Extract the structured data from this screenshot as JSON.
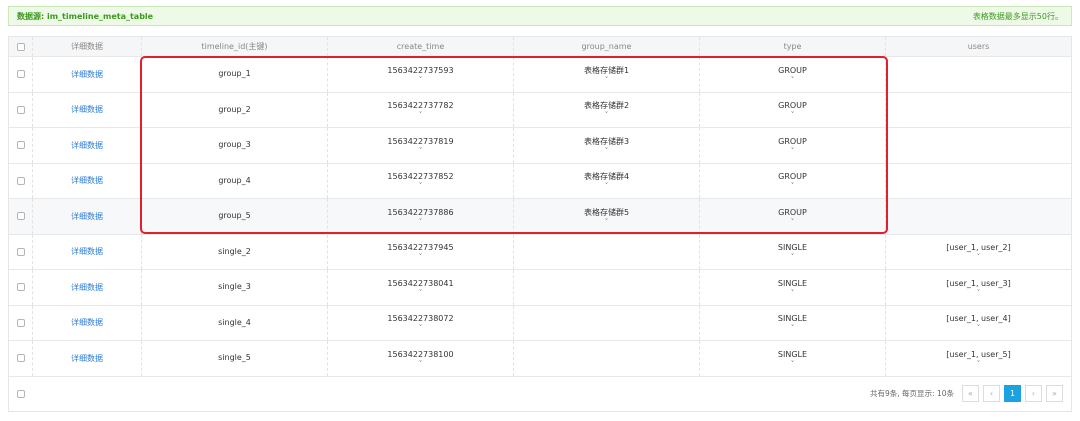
{
  "banner": {
    "source_label": "数据源: im_timeline_meta_table",
    "limit_note": "表格数据最多显示50行。"
  },
  "table": {
    "headers": [
      "详细数据",
      "timeline_id(主键)",
      "create_time",
      "group_name",
      "type",
      "users"
    ],
    "rows": [
      {
        "detail": "详细数据",
        "timeline_id": "group_1",
        "create_time": "1563422737593",
        "group_name": "表格存储群1",
        "type": "GROUP",
        "users": ""
      },
      {
        "detail": "详细数据",
        "timeline_id": "group_2",
        "create_time": "1563422737782",
        "group_name": "表格存储群2",
        "type": "GROUP",
        "users": ""
      },
      {
        "detail": "详细数据",
        "timeline_id": "group_3",
        "create_time": "1563422737819",
        "group_name": "表格存储群3",
        "type": "GROUP",
        "users": ""
      },
      {
        "detail": "详细数据",
        "timeline_id": "group_4",
        "create_time": "1563422737852",
        "group_name": "表格存储群4",
        "type": "GROUP",
        "users": ""
      },
      {
        "detail": "详细数据",
        "timeline_id": "group_5",
        "create_time": "1563422737886",
        "group_name": "表格存储群5",
        "type": "GROUP",
        "users": ""
      },
      {
        "detail": "详细数据",
        "timeline_id": "single_2",
        "create_time": "1563422737945",
        "group_name": "",
        "type": "SINGLE",
        "users": "[user_1, user_2]"
      },
      {
        "detail": "详细数据",
        "timeline_id": "single_3",
        "create_time": "1563422738041",
        "group_name": "",
        "type": "SINGLE",
        "users": "[user_1, user_3]"
      },
      {
        "detail": "详细数据",
        "timeline_id": "single_4",
        "create_time": "1563422738072",
        "group_name": "",
        "type": "SINGLE",
        "users": "[user_1, user_4]"
      },
      {
        "detail": "详细数据",
        "timeline_id": "single_5",
        "create_time": "1563422738100",
        "group_name": "",
        "type": "SINGLE",
        "users": "[user_1, user_5]"
      }
    ]
  },
  "pagination": {
    "summary": "共有9条, 每页显示: 10条",
    "first": "«",
    "prev": "‹",
    "current_page": "1",
    "next": "›",
    "last": "»"
  },
  "icons": {
    "expand": "chevron-down-icon",
    "checkbox": "checkbox-icon"
  },
  "colors": {
    "banner_text": "#3c9a1e",
    "banner_bg": "#eef9e8",
    "link": "#2a7bd8",
    "active_page": "#1aa3e0",
    "highlight_border": "#e0202e"
  }
}
